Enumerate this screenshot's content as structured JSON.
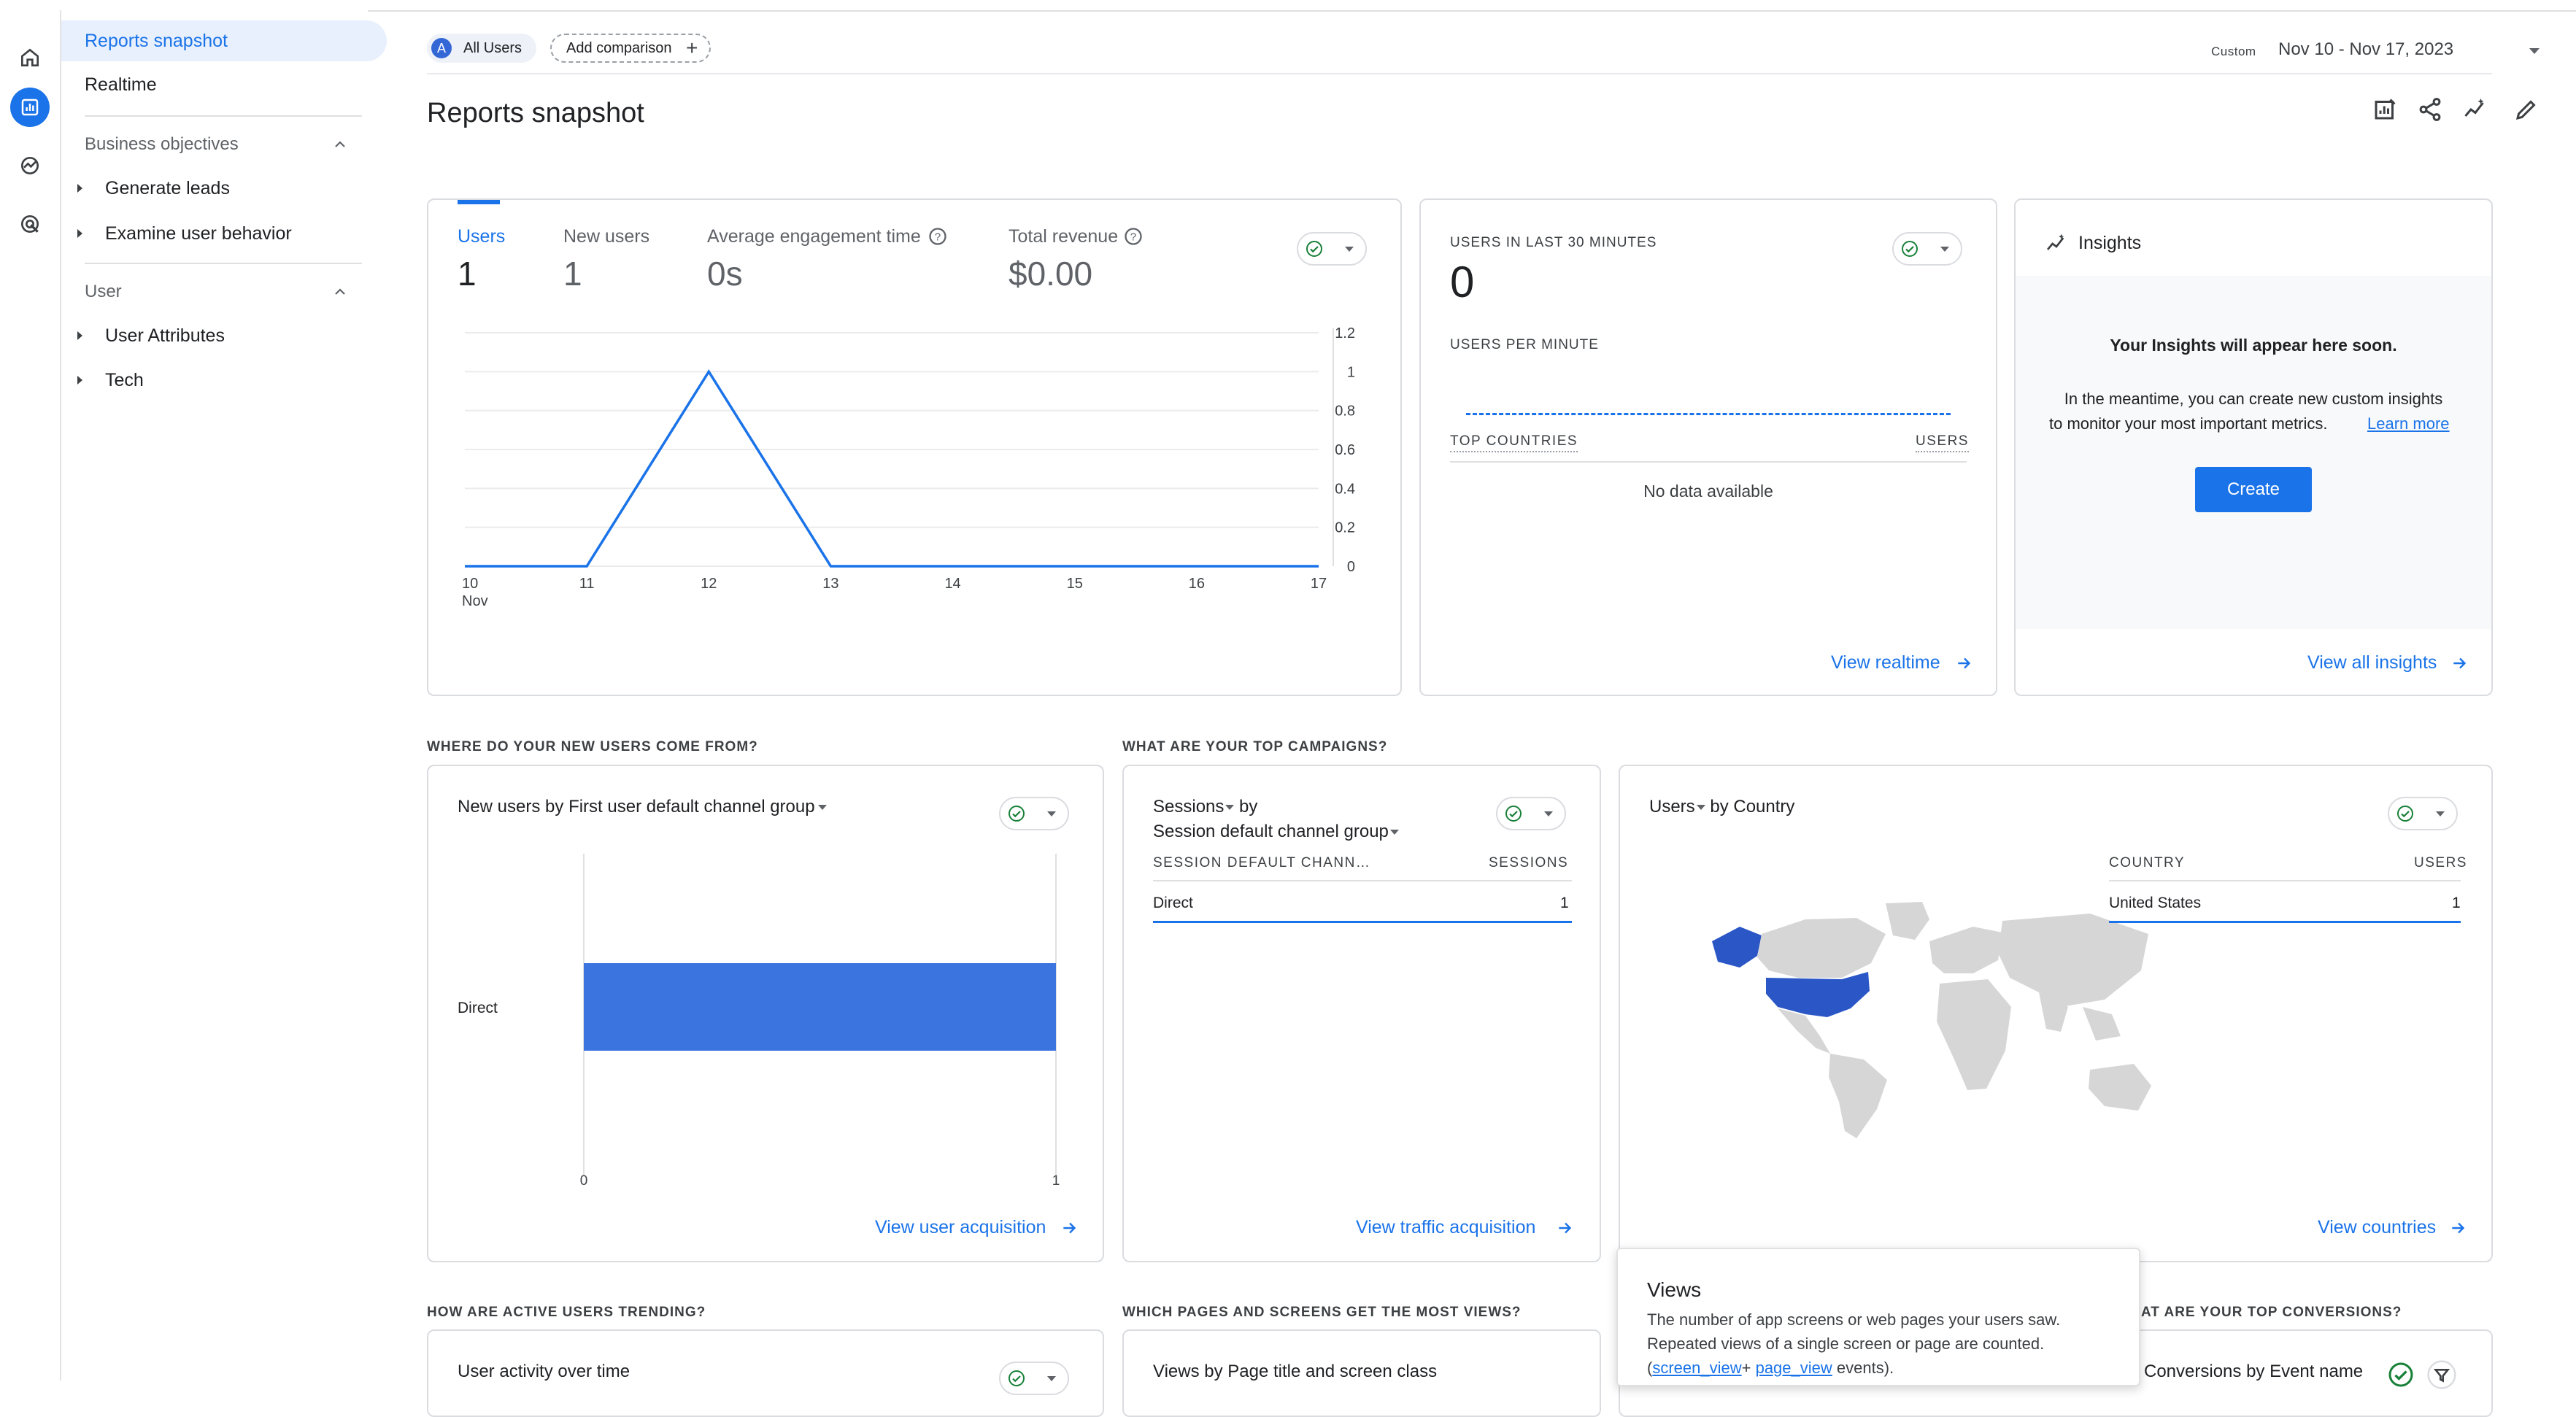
{
  "nav": {
    "reports_snapshot": "Reports snapshot",
    "realtime": "Realtime",
    "section_business": "Business objectives",
    "generate_leads": "Generate leads",
    "examine_user_behavior": "Examine user behavior",
    "section_user": "User",
    "user_attributes": "User Attributes",
    "tech": "Tech"
  },
  "header": {
    "all_users_badge": "A",
    "all_users": "All Users",
    "add_comparison": "Add comparison",
    "date_custom": "Custom",
    "date_range": "Nov 10 - Nov 17, 2023",
    "page_title": "Reports snapshot"
  },
  "main_card": {
    "metrics": [
      {
        "label": "Users",
        "value": "1"
      },
      {
        "label": "New users",
        "value": "1"
      },
      {
        "label": "Average engagement time",
        "value": "0s"
      },
      {
        "label": "Total revenue",
        "value": "$0.00"
      }
    ]
  },
  "chart_data": {
    "type": "line",
    "categories": [
      "10 Nov",
      "11",
      "12",
      "13",
      "14",
      "15",
      "16",
      "17"
    ],
    "series": [
      {
        "values": [
          0,
          0,
          1,
          0,
          0,
          0,
          0,
          0
        ]
      }
    ],
    "ylim": [
      0,
      1.2
    ],
    "yticks": [
      "1.2",
      "1",
      "0.8",
      "0.6",
      "0.4",
      "0.2",
      "0"
    ],
    "xtick_top": [
      "10",
      "11",
      "12",
      "13",
      "14",
      "15",
      "16",
      "17"
    ],
    "xtick_sub": "Nov",
    "color": "#1a73e8",
    "grid": true
  },
  "realtime_card": {
    "title": "USERS IN LAST 30 MINUTES",
    "value": "0",
    "per_minute": "USERS PER MINUTE",
    "top_countries": "TOP COUNTRIES",
    "users": "USERS",
    "no_data": "No data available",
    "link": "View realtime"
  },
  "insights_card": {
    "title": "Insights",
    "headline": "Your Insights will appear here soon.",
    "body_1": "In the meantime, you can create new custom insights",
    "body_2": "to monitor your most important metrics.",
    "learn_more": "Learn more",
    "create": "Create",
    "link": "View all insights"
  },
  "sections": {
    "new_users": "WHERE DO YOUR NEW USERS COME FROM?",
    "campaigns": "WHAT ARE YOUR TOP CAMPAIGNS?",
    "active_users": "HOW ARE ACTIVE USERS TRENDING?",
    "pages": "WHICH PAGES AND SCREENS GET THE MOST VIEWS?",
    "conversions": "AT ARE YOUR TOP CONVERSIONS?"
  },
  "acq_card": {
    "title_prefix": "New users by ",
    "title_dim": "First user default channel group",
    "bar_label": "Direct",
    "axis_min": "0",
    "axis_max": "1",
    "link": "View user acquisition"
  },
  "acq_chart": {
    "type": "bar",
    "categories": [
      "Direct"
    ],
    "values": [
      1
    ],
    "xlim": [
      0,
      1
    ],
    "color": "#3b73df"
  },
  "traffic_card": {
    "title_1": "Sessions",
    "title_by": " by",
    "title_2": "Session default channel group",
    "col_1": "SESSION DEFAULT CHANN…",
    "col_2": "SESSIONS",
    "row_label": "Direct",
    "row_value": "1",
    "link": "View traffic acquisition"
  },
  "country_card": {
    "title_1": "Users",
    "title_by": " by Country",
    "col_1": "COUNTRY",
    "col_2": "USERS",
    "row_label": "United States",
    "row_value": "1",
    "link": "View countries"
  },
  "bottom_cards": {
    "activity": "User activity over time",
    "views": "Views by Page title and screen class",
    "conversions": "Conversions by Event name"
  },
  "tooltip": {
    "title": "Views",
    "line_1": "The number of app screens or web pages your users saw.",
    "line_2": "Repeated views of a single screen or page are counted.",
    "open": "(",
    "screen_view": "screen_view",
    "plus": "+ ",
    "page_view": "page_view",
    "close": " events)."
  }
}
